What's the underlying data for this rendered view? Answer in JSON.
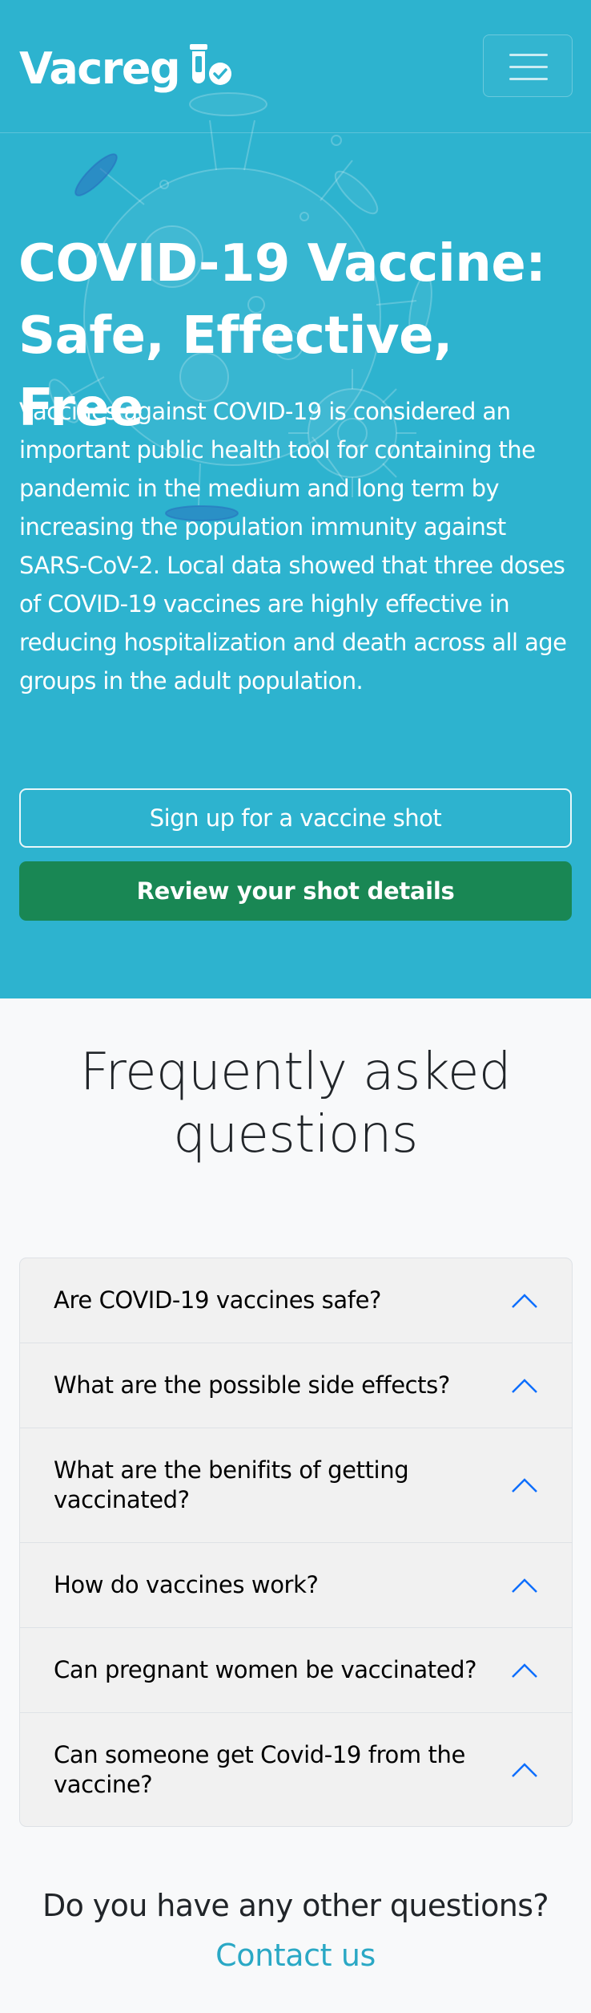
{
  "brand": {
    "name": "Vacreg",
    "logo_icon": "vaccine-vial-check-icon"
  },
  "nav": {
    "toggler_icon": "hamburger-menu-icon"
  },
  "hero": {
    "title_line1": "COVID-19 Vaccine:",
    "title_line2": "Safe, Effective, Free",
    "text_lines": [
      "Vaccines against COVID-19 is considered an",
      "important public health tool for containing the",
      "pandemic in the medium and long term by",
      "increasing the population immunity against",
      "SARS-CoV-2. Local data showed that three doses",
      "of COVID-19 vaccines are highly effective in",
      "reducing hospitalization and death across all age",
      "groups in the adult population."
    ],
    "signup_button": "Sign up for a vaccine shot",
    "review_button": "Review your shot details",
    "background_color": "#2db3cf",
    "green_color": "#198754"
  },
  "faq": {
    "title_line1": "Frequently asked",
    "title_line2": "questions",
    "items": [
      {
        "line1": "Are COVID-19 vaccines safe?",
        "line2": ""
      },
      {
        "line1": "What are the possible side effects?",
        "line2": ""
      },
      {
        "line1": "What are the benifits of getting",
        "line2": "vaccinated?"
      },
      {
        "line1": "How do vaccines work?",
        "line2": ""
      },
      {
        "line1": "Can pregnant women be vaccinated?",
        "line2": ""
      },
      {
        "line1": "Can someone get Covid-19 from the",
        "line2": "vaccine?"
      }
    ],
    "chevron_icon": "chevron-up-icon",
    "chevron_color": "#0d6efd"
  },
  "footer": {
    "question": "Do you have any other questions?",
    "contact_link": "Contact us",
    "link_color": "#2aa8c5"
  }
}
